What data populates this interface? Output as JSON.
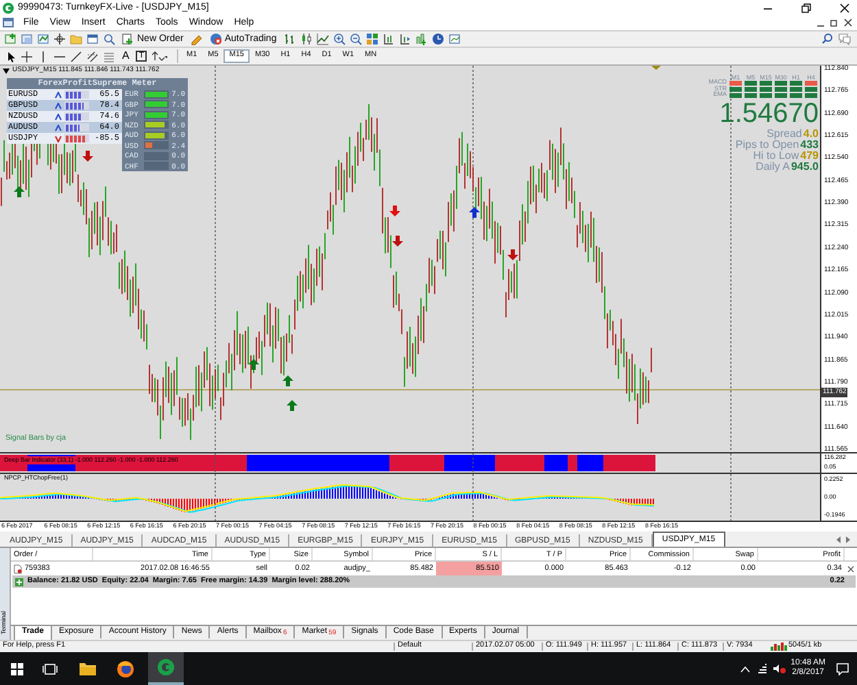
{
  "window": {
    "title": "99990473: TurnkeyFX-Live - [USDJPY_M15]"
  },
  "menu": [
    {
      "label": "File"
    },
    {
      "label": "View"
    },
    {
      "label": "Insert"
    },
    {
      "label": "Charts"
    },
    {
      "label": "Tools"
    },
    {
      "label": "Window"
    },
    {
      "label": "Help"
    }
  ],
  "toolbar": {
    "buttons": [
      {
        "label": "New Order"
      },
      {
        "label": "AutoTrading"
      }
    ]
  },
  "drawing_tools": [
    {
      "label": "A"
    },
    {
      "label": "T"
    }
  ],
  "timeframes": [
    {
      "label": "M1",
      "selected": false
    },
    {
      "label": "M5",
      "selected": false
    },
    {
      "label": "M15",
      "selected": true
    },
    {
      "label": "M30",
      "selected": false
    },
    {
      "label": "H1",
      "selected": false
    },
    {
      "label": "H4",
      "selected": false
    },
    {
      "label": "D1",
      "selected": false
    },
    {
      "label": "W1",
      "selected": false
    },
    {
      "label": "MN",
      "selected": false
    }
  ],
  "chart": {
    "header": "USDJPY_M15  111.845 111.846 111.743 111.762",
    "signal_label": "Signal Bars by cja",
    "price_scale": [
      "112.840",
      "112.765",
      "112.690",
      "112.615",
      "112.540",
      "112.465",
      "112.390",
      "112.315",
      "112.240",
      "112.165",
      "112.090",
      "112.015",
      "111.940",
      "111.865",
      "111.790",
      "111.715",
      "111.640",
      "111.565"
    ],
    "current_price": "111.762",
    "meter": {
      "title": "ForexProfitSupreme Meter",
      "pairs": [
        {
          "symbol": "EURUSD",
          "rising": true,
          "level": 0.655,
          "value": "65.5"
        },
        {
          "symbol": "GBPUSD",
          "rising": true,
          "level": 0.784,
          "value": "78.4"
        },
        {
          "symbol": "NZDUSD",
          "rising": true,
          "level": 0.746,
          "value": "74.6"
        },
        {
          "symbol": "AUDUSD",
          "rising": true,
          "level": 0.64,
          "value": "64.0"
        },
        {
          "symbol": "USDJPY",
          "rising": false,
          "level": 0.855,
          "value": "-85.5"
        }
      ],
      "currencies": [
        {
          "code": "EUR",
          "level": 1,
          "value": "7.0",
          "color": "#33cc33"
        },
        {
          "code": "GBP",
          "level": 1,
          "value": "7.0",
          "color": "#33cc33"
        },
        {
          "code": "JPY",
          "level": 1,
          "value": "7.0",
          "color": "#33cc33"
        },
        {
          "code": "NZD",
          "level": 0.857,
          "value": "6.0",
          "color": "#a8cc22"
        },
        {
          "code": "AUD",
          "level": 0.857,
          "value": "6.0",
          "color": "#a8cc22"
        },
        {
          "code": "USD",
          "level": 0.343,
          "value": "2.4",
          "color": "#e07040"
        },
        {
          "code": "CAD",
          "value": "0.0"
        },
        {
          "code": "CHF",
          "value": "0.0"
        }
      ]
    },
    "signals": {
      "columns": [
        {
          "label": "M1",
          "macd_up": false
        },
        {
          "label": "M5",
          "macd_up": true
        },
        {
          "label": "M15",
          "macd_up": true
        },
        {
          "label": "M30",
          "macd_up": true
        },
        {
          "label": "H1",
          "macd_up": true
        },
        {
          "label": "H4",
          "macd_up": false
        }
      ],
      "rows": [
        "MACD",
        "STR",
        "EMA"
      ],
      "price": "1.54670",
      "stats": [
        {
          "label": "Spread",
          "value": "4.0",
          "color": "#b89400"
        },
        {
          "label": "Pips to Open",
          "value": "433",
          "color": "#1f7a3f"
        },
        {
          "label": "Hi to Low",
          "value": "479",
          "color": "#b89400"
        },
        {
          "label": "Daily A",
          "value": "945.0",
          "color": "#1f7a3f"
        }
      ]
    },
    "deep_bar": {
      "label": "Deep Bar Indicator (33,1) -1.000 112.260 -1.000 -1.000 112.260",
      "scale": [
        "116.282",
        "0.05"
      ]
    },
    "oscillator": {
      "label": "NPCP_HTChopFree(1)",
      "scale": [
        "0.2252",
        "0.00",
        "-0.1946"
      ]
    },
    "time_axis": [
      "6 Feb 2017",
      "6 Feb 08:15",
      "6 Feb 12:15",
      "6 Feb 16:15",
      "6 Feb 20:15",
      "7 Feb 00:15",
      "7 Feb 04:15",
      "7 Feb 08:15",
      "7 Feb 12:15",
      "7 Feb 16:15",
      "7 Feb 20:15",
      "8 Feb 00:15",
      "8 Feb 04:15",
      "8 Feb 08:15",
      "8 Feb 12:15",
      "8 Feb 16:15"
    ]
  },
  "symbol_tabs": [
    {
      "label": "AUDJPY_M15",
      "selected": false
    },
    {
      "label": "AUDJPY_M15",
      "selected": false
    },
    {
      "label": "AUDCAD_M15",
      "selected": false
    },
    {
      "label": "AUDUSD_M15",
      "selected": false
    },
    {
      "label": "EURGBP_M15",
      "selected": false
    },
    {
      "label": "EURJPY_M15",
      "selected": false
    },
    {
      "label": "EURUSD_M15",
      "selected": false
    },
    {
      "label": "GBPUSD_M15",
      "selected": false
    },
    {
      "label": "NZDUSD_M15",
      "selected": false
    },
    {
      "label": "USDJPY_M15",
      "selected": true
    }
  ],
  "terminal": {
    "label": "Terminal",
    "columns": [
      "Order  /",
      "Time",
      "Type",
      "Size",
      "Symbol",
      "Price",
      "S / L",
      "T / P",
      "Price",
      "Commission",
      "Swap",
      "Profit"
    ],
    "rows": [
      {
        "cells": [
          "759383",
          "2017.02.08 16:46:55",
          "sell",
          "0.02",
          "audjpy_",
          "85.482",
          "85.510",
          "0.000",
          "85.463",
          "-0.12",
          "0.00",
          "0.34"
        ],
        "sl_hit": true
      }
    ],
    "balance": "Balance: 21.82 USD  Equity: 22.04  Margin: 7.65  Free margin: 14.39  Margin level: 288.20%",
    "balance_profit": "0.22",
    "tabs": [
      {
        "label": "Trade",
        "selected": true
      },
      {
        "label": "Exposure",
        "selected": false
      },
      {
        "label": "Account History",
        "selected": false
      },
      {
        "label": "News",
        "selected": false
      },
      {
        "label": "Alerts",
        "selected": false
      },
      {
        "label": "Mailbox",
        "badge": "6",
        "selected": false
      },
      {
        "label": "Market",
        "badge": "59",
        "selected": false
      },
      {
        "label": "Signals",
        "selected": false
      },
      {
        "label": "Code Base",
        "selected": false
      },
      {
        "label": "Experts",
        "selected": false
      },
      {
        "label": "Journal",
        "selected": false
      }
    ]
  },
  "status_bar": {
    "help": "For Help, press F1",
    "profile": "Default",
    "fields": [
      "2017.02.07 05:00",
      "O: 111.949",
      "H: 111.957",
      "L: 111.864",
      "C: 111.873",
      "V: 7934"
    ],
    "traffic": "5045/1 kb"
  },
  "taskbar": {
    "time": "10:48 AM",
    "date": "2/8/2017"
  }
}
